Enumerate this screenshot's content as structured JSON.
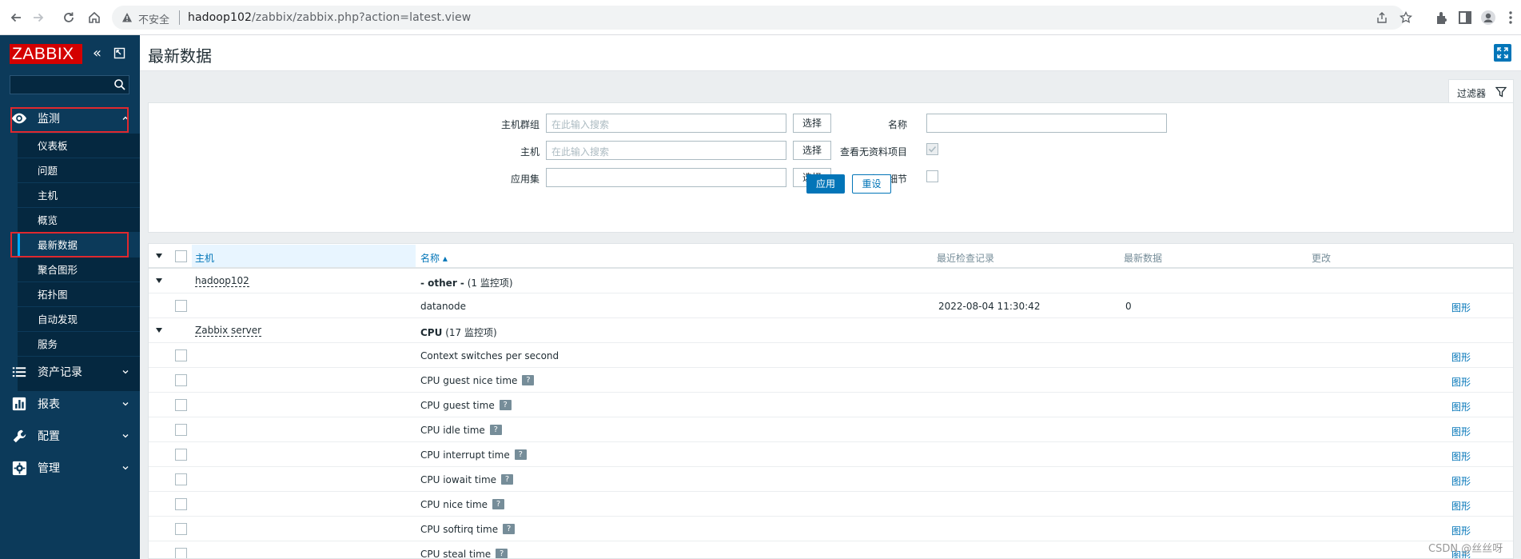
{
  "browser": {
    "security_label": "不安全",
    "url_host": "hadoop102",
    "url_path": "/zabbix/zabbix.php?action=latest.view"
  },
  "sidebar": {
    "logo": "ZABBIX",
    "collapse_icon": "«",
    "menu": [
      {
        "label": "监测",
        "icon": "eye-icon",
        "expanded": true
      },
      {
        "label": "资产记录",
        "icon": "list-icon"
      },
      {
        "label": "报表",
        "icon": "bar-chart-icon"
      },
      {
        "label": "配置",
        "icon": "wrench-icon"
      },
      {
        "label": "管理",
        "icon": "gear-icon"
      }
    ],
    "submenu": [
      {
        "label": "仪表板"
      },
      {
        "label": "问题"
      },
      {
        "label": "主机"
      },
      {
        "label": "概览"
      },
      {
        "label": "最新数据",
        "active": true
      },
      {
        "label": "聚合图形"
      },
      {
        "label": "拓扑图"
      },
      {
        "label": "自动发现"
      },
      {
        "label": "服务"
      }
    ]
  },
  "page": {
    "title": "最新数据",
    "filter_tab_label": "过滤器"
  },
  "filter": {
    "host_group_label": "主机群组",
    "host_group_placeholder": "在此输入搜索",
    "host_label": "主机",
    "host_placeholder": "在此输入搜索",
    "app_label": "应用集",
    "app_value": "",
    "select_label": "选择",
    "name_label": "名称",
    "name_value": "",
    "show_no_data_label": "查看无资料项目",
    "show_no_data_checked": true,
    "show_details_label": "查看细节",
    "show_details_checked": false,
    "apply_label": "应用",
    "reset_label": "重设"
  },
  "table": {
    "headers": {
      "host": "主机",
      "name": "名称 ▴",
      "last_check": "最近检查记录",
      "last_value": "最新数据",
      "change": "更改"
    },
    "graph_label": "图形",
    "groups": [
      {
        "host": "hadoop102",
        "app_name": "- other -",
        "app_count": "(1 监控项)",
        "items": [
          {
            "name": "datanode",
            "last_check": "2022-08-04 11:30:42",
            "last_value": "0",
            "help": false
          }
        ]
      },
      {
        "host": "Zabbix server",
        "app_name": "CPU",
        "app_count": "(17 监控项)",
        "items": [
          {
            "name": "Context switches per second",
            "help": false
          },
          {
            "name": "CPU guest nice time",
            "help": true
          },
          {
            "name": "CPU guest time",
            "help": true
          },
          {
            "name": "CPU idle time",
            "help": true
          },
          {
            "name": "CPU interrupt time",
            "help": true
          },
          {
            "name": "CPU iowait time",
            "help": true
          },
          {
            "name": "CPU nice time",
            "help": true
          },
          {
            "name": "CPU softirq time",
            "help": true
          },
          {
            "name": "CPU steal time",
            "help": true
          }
        ]
      }
    ],
    "help_icon": "?"
  },
  "watermark": "CSDN @丝丝呀",
  "colors": {
    "sidebar_bg": "#0c3a5a",
    "submenu_bg": "#052840",
    "accent": "#0275b8",
    "logo_red": "#d40000",
    "highlight_box": "#e0282e"
  }
}
